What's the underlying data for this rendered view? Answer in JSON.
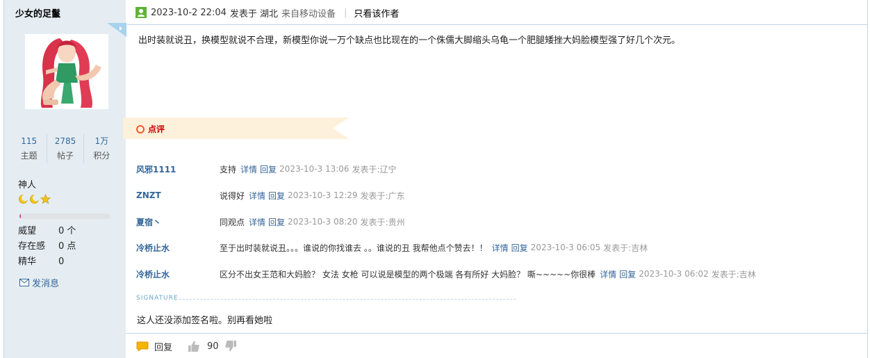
{
  "user": {
    "name": "少女的足鬣",
    "stats": [
      {
        "value": "115",
        "label": "主题"
      },
      {
        "value": "2785",
        "label": "帖子"
      },
      {
        "value": "1万",
        "label": "积分"
      }
    ],
    "rank": "神人",
    "level_progress": 0.01,
    "info": [
      {
        "key": "威望",
        "value": "0 个"
      },
      {
        "key": "存在感",
        "value": "0 点"
      },
      {
        "key": "精华",
        "value": "0"
      }
    ],
    "send_message_label": "发消息"
  },
  "post": {
    "time": "2023-10-2 22:04",
    "posted_in_label": "发表于 湖北",
    "source": "来自移动设备",
    "only_author_label": "只看该作者",
    "content": "出时装就说丑，换模型就说不合理，新模型你说一万个缺点也比现在的一个侏儒大脚缩头乌龟一个肥腿矮挫大妈脸模型强了好几个次元。"
  },
  "comments_section": {
    "title": "点评",
    "detail_label": "详情",
    "reply_label": "回复",
    "items": [
      {
        "author": "风邪1111",
        "body": "支持",
        "time": "2023-10-3 13:06",
        "loc": "发表于:辽宁"
      },
      {
        "author": "ZNZT",
        "body": "说得好",
        "time": "2023-10-3 12:29",
        "loc": "发表于:广东"
      },
      {
        "author": "夏宿丶",
        "body": "同观点",
        "time": "2023-10-3 08:20",
        "loc": "发表于:贵州"
      },
      {
        "author": "冷桥止水",
        "body": "至于出时装就说丑。。。谁说的你找谁去 。。谁说的丑 我帮他点个赞去！！",
        "time": "2023-10-3 06:05",
        "loc": "发表于:吉林"
      },
      {
        "author": "冷桥止水",
        "body": "区分不出女王范和大妈脸？  女法 女枪 可以说是模型的两个极端 各有所好 大妈脸？ 嘶~~~~~你很棒",
        "time": "2023-10-3 06:02",
        "loc": "发表于:吉林"
      }
    ]
  },
  "signature": {
    "label": "SIGNATURE",
    "text": "这人还没添加签名啦。别再看她啦"
  },
  "actions": {
    "reply_label": "回复",
    "like_count": "90"
  }
}
